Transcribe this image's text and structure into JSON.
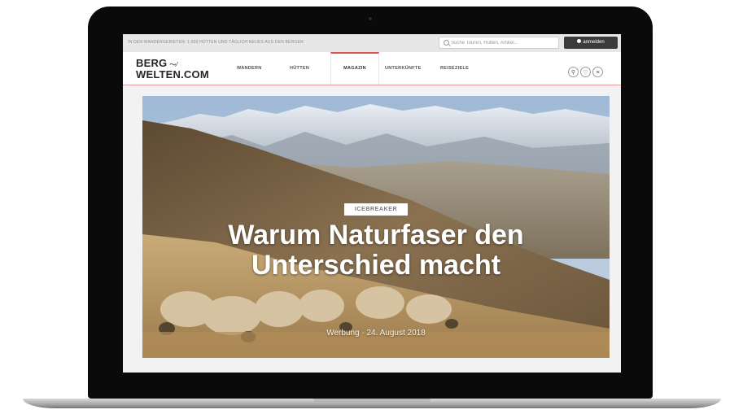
{
  "topbar": {
    "tagline": "IN DEN WANDERGEBIETEN: 1.000 HÜTTEN UND TÄGLICH NEUES AUS DEN BERGEN",
    "search_placeholder": "Suche Touren, Hütten, Artikel...",
    "login_label": "anmelden"
  },
  "logo": {
    "line1": "BERG",
    "line2": "WELTEN.COM"
  },
  "nav": {
    "items": [
      "WANDERN",
      "HÜTTEN",
      "MAGAZIN",
      "UNTERKÜNFTE",
      "REISEZIELE"
    ],
    "active": "MAGAZIN",
    "icons": [
      "map-pin-icon",
      "heart-icon",
      "menu-icon"
    ]
  },
  "hero": {
    "kicker": "ICEBREAKER",
    "headline": "Warum Naturfaser den Unterschied macht",
    "byline": "Werbung · 24. August 2018"
  }
}
